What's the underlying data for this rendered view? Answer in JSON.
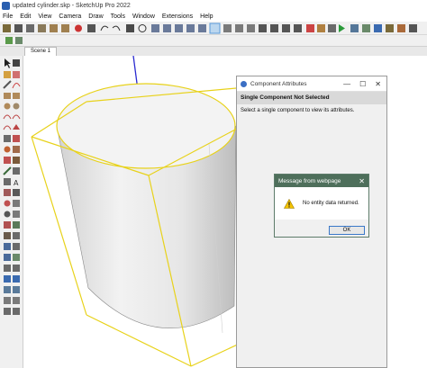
{
  "window": {
    "title": "updated cylinder.skp - SketchUp Pro 2022"
  },
  "menu": [
    "File",
    "Edit",
    "View",
    "Camera",
    "Draw",
    "Tools",
    "Window",
    "Extensions",
    "Help"
  ],
  "scene_tab": {
    "label": "Scene 1"
  },
  "component_panel": {
    "title": "Component Attributes",
    "heading": "Single Component Not Selected",
    "description": "Select a single component to view its attributes.",
    "minimize_glyph": "—",
    "maximize_glyph": "☐",
    "close_glyph": "✕"
  },
  "message_dialog": {
    "title": "Message from webpage",
    "message": "No entity data returned.",
    "ok_label": "OK",
    "close_glyph": "✕",
    "icon": "warning-icon"
  },
  "colors": {
    "selection_yellow": "#e8d21a",
    "axis_blue": "#2a2ad0",
    "dialog_titlebar": "#4e6f5b"
  }
}
